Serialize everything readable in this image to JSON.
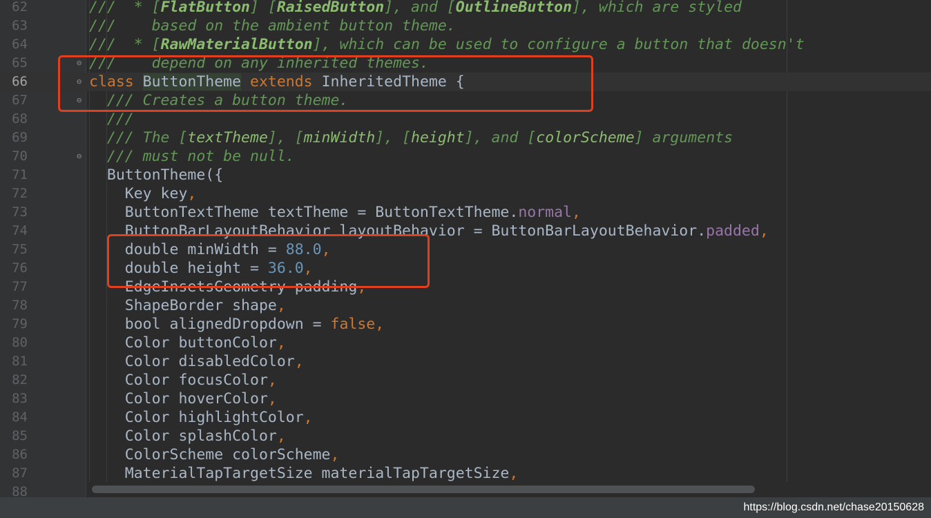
{
  "editor": {
    "current_line": "66",
    "lines": [
      {
        "n": "62",
        "segs": [
          [
            "c",
            "///  * ["
          ],
          [
            "cb",
            "FlatButton"
          ],
          [
            "c",
            "] ["
          ],
          [
            "cb",
            "RaisedButton"
          ],
          [
            "c",
            "], and ["
          ],
          [
            "cb",
            "OutlineButton"
          ],
          [
            "c",
            "], which are styled"
          ]
        ]
      },
      {
        "n": "63",
        "segs": [
          [
            "c",
            "///    based on the ambient button theme."
          ]
        ]
      },
      {
        "n": "64",
        "segs": [
          [
            "c",
            "///  * ["
          ],
          [
            "cb",
            "RawMaterialButton"
          ],
          [
            "c",
            "], which can be used to configure a button that doesn't"
          ]
        ]
      },
      {
        "n": "65",
        "segs": [
          [
            "c",
            "///    depend on any inherited themes."
          ]
        ]
      },
      {
        "n": "66",
        "segs": [
          [
            "kw",
            "class "
          ],
          [
            "hl",
            "ButtonTheme"
          ],
          [
            "p",
            " "
          ],
          [
            "kw",
            "extends "
          ],
          [
            "p",
            "InheritedTheme {"
          ]
        ]
      },
      {
        "n": "67",
        "segs": [
          [
            "p",
            "  "
          ],
          [
            "c",
            "/// Creates a button theme."
          ]
        ]
      },
      {
        "n": "68",
        "segs": [
          [
            "p",
            "  "
          ],
          [
            "c",
            "///"
          ]
        ]
      },
      {
        "n": "69",
        "segs": [
          [
            "p",
            "  "
          ],
          [
            "c",
            "/// The ["
          ],
          [
            "cr",
            "textTheme"
          ],
          [
            "c",
            "], ["
          ],
          [
            "cr",
            "minWidth"
          ],
          [
            "c",
            "], ["
          ],
          [
            "cr",
            "height"
          ],
          [
            "c",
            "], and ["
          ],
          [
            "cr",
            "colorScheme"
          ],
          [
            "c",
            "] arguments"
          ]
        ]
      },
      {
        "n": "70",
        "segs": [
          [
            "p",
            "  "
          ],
          [
            "c",
            "/// must not be null."
          ]
        ]
      },
      {
        "n": "71",
        "segs": [
          [
            "p",
            "  ButtonTheme({"
          ]
        ]
      },
      {
        "n": "72",
        "segs": [
          [
            "p",
            "    Key key"
          ],
          [
            "kw",
            ","
          ]
        ]
      },
      {
        "n": "73",
        "segs": [
          [
            "p",
            "    ButtonTextTheme textTheme = ButtonTextTheme."
          ],
          [
            "field",
            "normal"
          ],
          [
            "kw",
            ","
          ]
        ]
      },
      {
        "n": "74",
        "segs": [
          [
            "p",
            "    ButtonBarLayoutBehavior layoutBehavior = ButtonBarLayoutBehavior."
          ],
          [
            "field",
            "padded"
          ],
          [
            "kw",
            ","
          ]
        ]
      },
      {
        "n": "75",
        "segs": [
          [
            "p",
            "    double minWidth = "
          ],
          [
            "num",
            "88.0"
          ],
          [
            "kw",
            ","
          ]
        ]
      },
      {
        "n": "76",
        "segs": [
          [
            "p",
            "    double height = "
          ],
          [
            "num",
            "36.0"
          ],
          [
            "kw",
            ","
          ]
        ]
      },
      {
        "n": "77",
        "segs": [
          [
            "p",
            "    EdgeInsetsGeometry padding"
          ],
          [
            "kw",
            ","
          ]
        ]
      },
      {
        "n": "78",
        "segs": [
          [
            "p",
            "    ShapeBorder shape"
          ],
          [
            "kw",
            ","
          ]
        ]
      },
      {
        "n": "79",
        "segs": [
          [
            "p",
            "    bool alignedDropdown = "
          ],
          [
            "kw",
            "false,"
          ]
        ]
      },
      {
        "n": "80",
        "segs": [
          [
            "p",
            "    Color buttonColor"
          ],
          [
            "kw",
            ","
          ]
        ]
      },
      {
        "n": "81",
        "segs": [
          [
            "p",
            "    Color disabledColor"
          ],
          [
            "kw",
            ","
          ]
        ]
      },
      {
        "n": "82",
        "segs": [
          [
            "p",
            "    Color focusColor"
          ],
          [
            "kw",
            ","
          ]
        ]
      },
      {
        "n": "83",
        "segs": [
          [
            "p",
            "    Color hoverColor"
          ],
          [
            "kw",
            ","
          ]
        ]
      },
      {
        "n": "84",
        "segs": [
          [
            "p",
            "    Color highlightColor"
          ],
          [
            "kw",
            ","
          ]
        ]
      },
      {
        "n": "85",
        "segs": [
          [
            "p",
            "    Color splashColor"
          ],
          [
            "kw",
            ","
          ]
        ]
      },
      {
        "n": "86",
        "segs": [
          [
            "p",
            "    ColorScheme colorScheme"
          ],
          [
            "kw",
            ","
          ]
        ]
      },
      {
        "n": "87",
        "segs": [
          [
            "p",
            "    MaterialTapTargetSize materialTapTargetSize"
          ],
          [
            "kw",
            ","
          ]
        ]
      },
      {
        "n": "88",
        "segs": []
      }
    ],
    "fold_markers": {
      "65": "⊖",
      "66": "⊖",
      "67": "⊖",
      "70": "⊖"
    }
  },
  "colors": {
    "background": "#2b2b2b",
    "comment": "#629755",
    "keyword": "#cc7832",
    "number": "#6897bb",
    "field": "#9876aa",
    "text": "#a9b7c6",
    "annotation_box": "#e0401e"
  },
  "watermark": "https://blog.csdn.net/chase20150628"
}
